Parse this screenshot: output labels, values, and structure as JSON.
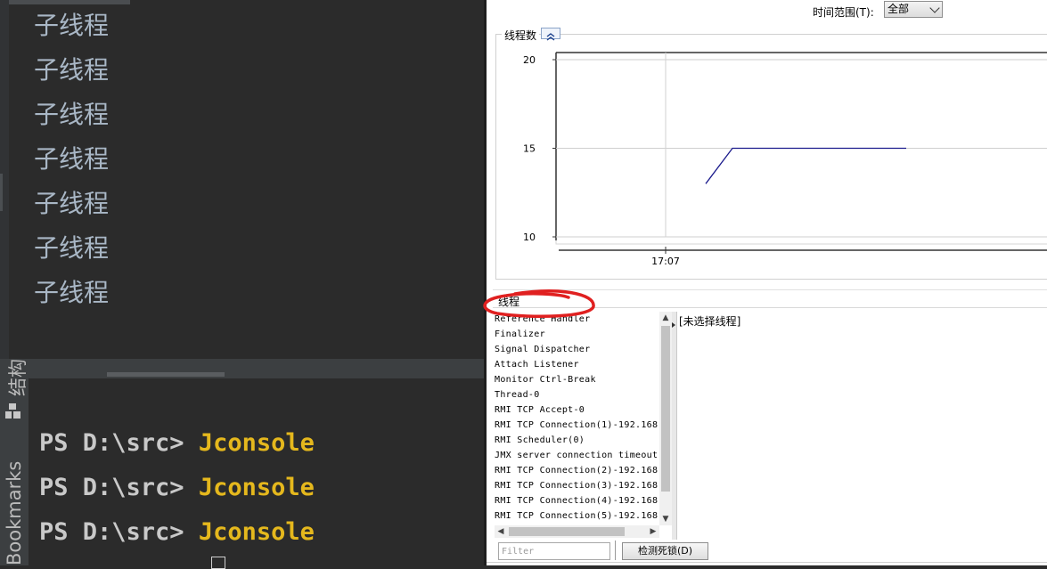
{
  "ide": {
    "output_lines": [
      "子线程",
      "子线程",
      "子线程",
      "子线程",
      "子线程",
      "子线程",
      "子线程"
    ],
    "side_tabs": {
      "structure": "结构",
      "bookmarks": "Bookmarks"
    },
    "terminal": [
      {
        "prompt": "PS D:\\src> ",
        "command": "Jconsole"
      },
      {
        "prompt": "PS D:\\src> ",
        "command": "Jconsole"
      },
      {
        "prompt": "PS D:\\src> ",
        "command": "Jconsole"
      }
    ]
  },
  "jconsole": {
    "time_range": {
      "label": "时间范围(T):",
      "value": "全部"
    },
    "chart_panel_title": "线程数",
    "threads_section_label": "线程",
    "threads": [
      "Reference Handler",
      "Finalizer",
      "Signal Dispatcher",
      "Attach Listener",
      "Monitor Ctrl-Break",
      "Thread-0",
      "RMI TCP Accept-0",
      "RMI TCP Connection(1)-192.168.",
      "RMI Scheduler(0)",
      "JMX server connection timeout",
      "RMI TCP Connection(2)-192.168.",
      "RMI TCP Connection(3)-192.168.",
      "RMI TCP Connection(4)-192.168.",
      "RMI TCP Connection(5)-192.168."
    ],
    "detail_text": "[未选择线程]",
    "filter_placeholder": "Filter",
    "detect_deadlock_label": "检测死锁(D)",
    "annotation_color": "#e02020",
    "line_color": "#1a1a8c"
  },
  "chart_data": {
    "type": "line",
    "title": "线程数",
    "ylim": [
      10,
      20
    ],
    "yticks": [
      10,
      15,
      20
    ],
    "xtick_labels": [
      "17:07"
    ],
    "series": [
      {
        "x": [
          "17:07:30",
          "17:07:50",
          "17:10"
        ],
        "values": [
          13,
          15,
          15
        ]
      }
    ],
    "grid": true
  }
}
